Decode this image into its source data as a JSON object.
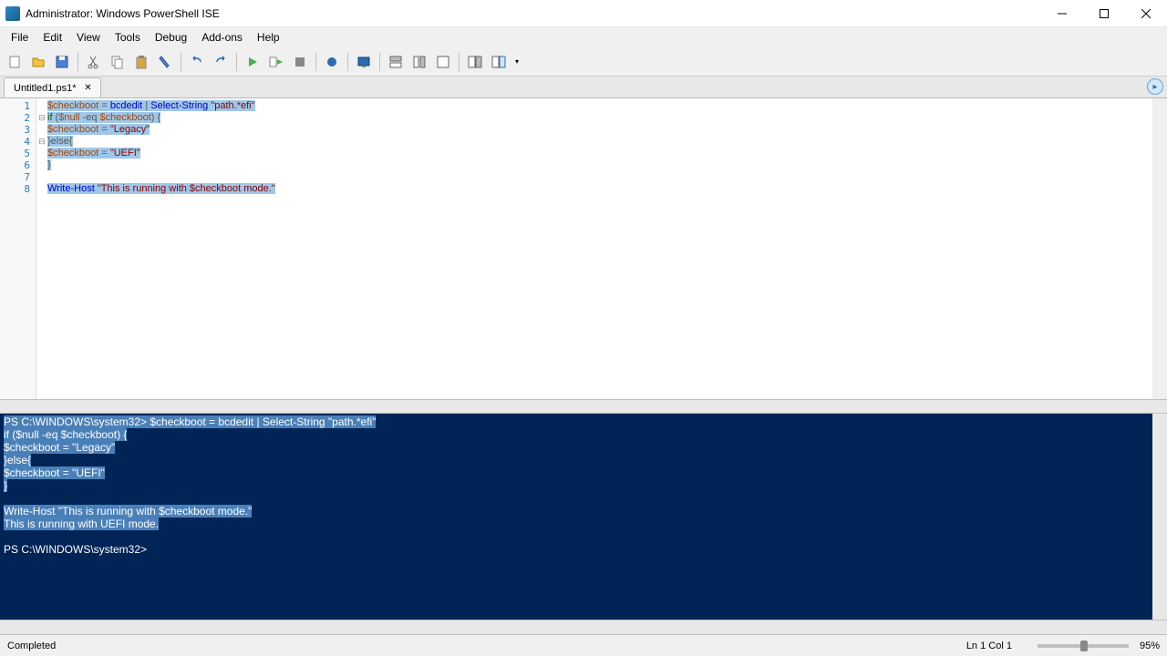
{
  "window": {
    "title": "Administrator: Windows PowerShell ISE"
  },
  "menu": {
    "items": [
      "File",
      "Edit",
      "View",
      "Tools",
      "Debug",
      "Add-ons",
      "Help"
    ]
  },
  "tab": {
    "name": "Untitled1.ps1*"
  },
  "editor": {
    "lines": [
      {
        "num": "1",
        "fold": "",
        "tokens": [
          {
            "t": "$checkboot",
            "c": "k-var"
          },
          {
            "t": " = ",
            "c": "k-op"
          },
          {
            "t": "bcdedit",
            "c": "k-cmd"
          },
          {
            "t": " | ",
            "c": "k-op"
          },
          {
            "t": "Select-String",
            "c": "k-cmd"
          },
          {
            "t": " ",
            "c": ""
          },
          {
            "t": "\"path.*efi\"",
            "c": "k-str"
          }
        ],
        "selected": true
      },
      {
        "num": "2",
        "fold": "⊟",
        "tokens": [
          {
            "t": "if",
            "c": "k-key"
          },
          {
            "t": " (",
            "c": "k-op"
          },
          {
            "t": "$null",
            "c": "k-var"
          },
          {
            "t": " -eq ",
            "c": "k-op"
          },
          {
            "t": "$checkboot",
            "c": "k-var"
          },
          {
            "t": ") {",
            "c": "k-op"
          }
        ],
        "selected": true
      },
      {
        "num": "3",
        "fold": "",
        "tokens": [
          {
            "t": "$checkboot",
            "c": "k-var"
          },
          {
            "t": " = ",
            "c": "k-op"
          },
          {
            "t": "\"Legacy\"",
            "c": "k-str"
          }
        ],
        "selected": true
      },
      {
        "num": "4",
        "fold": "⊟",
        "tokens": [
          {
            "t": "}else{",
            "c": "k-op"
          }
        ],
        "selected": true
      },
      {
        "num": "5",
        "fold": "",
        "tokens": [
          {
            "t": "$checkboot",
            "c": "k-var"
          },
          {
            "t": " = ",
            "c": "k-op"
          },
          {
            "t": "\"UEFI\"",
            "c": "k-str"
          }
        ],
        "selected": true
      },
      {
        "num": "6",
        "fold": "",
        "tokens": [
          {
            "t": "}",
            "c": "k-op"
          }
        ],
        "selected": true
      },
      {
        "num": "7",
        "fold": "",
        "tokens": [
          {
            "t": "",
            "c": ""
          }
        ],
        "selected": false
      },
      {
        "num": "8",
        "fold": "",
        "tokens": [
          {
            "t": "Write-Host",
            "c": "k-cmd"
          },
          {
            "t": " ",
            "c": ""
          },
          {
            "t": "\"This is running with $checkboot mode.\"",
            "c": "k-str"
          }
        ],
        "selected": true
      }
    ]
  },
  "console": {
    "lines": [
      {
        "text": "PS C:\\WINDOWS\\system32> $checkboot = bcdedit | Select-String \"path.*efi\"",
        "sel": true
      },
      {
        "text": "if ($null -eq $checkboot) {",
        "sel": true
      },
      {
        "text": "$checkboot = \"Legacy\"",
        "sel": true
      },
      {
        "text": "}else{",
        "sel": true
      },
      {
        "text": "$checkboot = \"UEFI\"",
        "sel": true
      },
      {
        "text": "}",
        "sel": true
      },
      {
        "text": "",
        "sel": false
      },
      {
        "text": "Write-Host \"This is running with $checkboot mode.\"",
        "sel": true
      },
      {
        "text": "This is running with UEFI mode.",
        "sel": true
      },
      {
        "text": "",
        "sel": false
      },
      {
        "text": "PS C:\\WINDOWS\\system32> ",
        "sel": false
      }
    ]
  },
  "status": {
    "message": "Completed",
    "position": "Ln 1  Col 1",
    "zoom": "95%"
  },
  "icons": {
    "new": "new-icon",
    "open": "open-icon",
    "save": "save-icon",
    "cut": "cut-icon",
    "copy": "copy-icon",
    "paste": "paste-icon",
    "clear": "clear-icon",
    "undo": "undo-icon",
    "redo": "redo-icon",
    "run": "run-icon",
    "run_sel": "run-selection-icon",
    "stop": "stop-icon",
    "breakpoint": "breakpoint-icon",
    "new_remote": "new-remote-icon",
    "start_ps": "start-ps-icon",
    "show_script": "show-script-top-icon",
    "show_side": "show-script-right-icon",
    "show_max": "show-script-max-icon",
    "show_cmd": "show-command-icon",
    "show_cmd_addon": "show-command-addon-icon"
  }
}
